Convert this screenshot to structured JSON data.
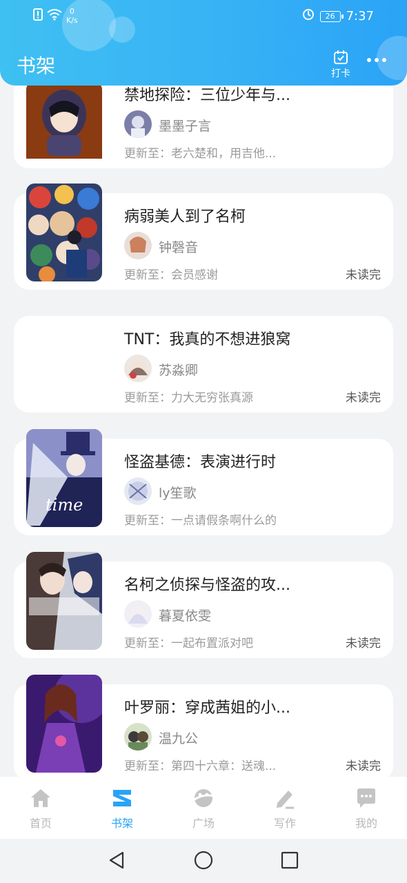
{
  "status_bar": {
    "net_speed_top": "0",
    "net_speed_unit": "K/s",
    "battery": "26",
    "time": "7:37"
  },
  "header": {
    "title": "书架",
    "checkin_label": "打卡"
  },
  "books": [
    {
      "title": "禁地探险：三位少年与...",
      "author": "墨墨子言",
      "update": "更新至：老六楚和，用吉他...",
      "unread": ""
    },
    {
      "title": "病弱美人到了名柯",
      "author": "钟磬音",
      "update": "更新至：会员感谢",
      "unread": "未读完"
    },
    {
      "title": "TNT：我真的不想进狼窝",
      "author": "苏淼卿",
      "update": "更新至：力大无穷张真源",
      "unread": "未读完"
    },
    {
      "title": "怪盗基德：表演进行时",
      "author": "ly笙歌",
      "update": "更新至：一点请假条啊什么的",
      "unread": ""
    },
    {
      "title": "名柯之侦探与怪盗的攻...",
      "author": "暮夏依雯",
      "update": "更新至：一起布置派对吧",
      "unread": "未读完"
    },
    {
      "title": "叶罗丽：穿成茜姐的小...",
      "author": "温九公",
      "update": "更新至：第四十六章：送魂...",
      "unread": "未读完"
    }
  ],
  "tabs": [
    {
      "label": "首页",
      "icon": "home-icon"
    },
    {
      "label": "书架",
      "icon": "bookshelf-icon"
    },
    {
      "label": "广场",
      "icon": "planet-icon"
    },
    {
      "label": "写作",
      "icon": "pen-icon"
    },
    {
      "label": "我的",
      "icon": "chat-bubble-icon"
    }
  ],
  "colors": {
    "accent": "#2aa3f6",
    "header_start": "#3fc0f2",
    "inactive": "#b8b8b8"
  }
}
